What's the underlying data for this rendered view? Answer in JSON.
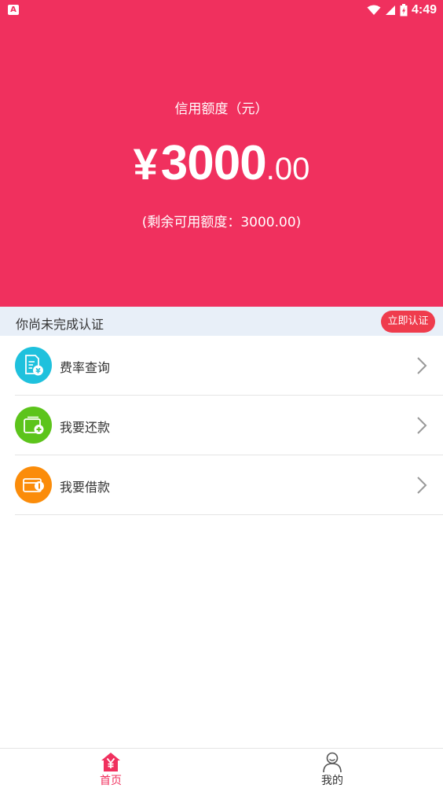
{
  "status_bar": {
    "time": "4:49"
  },
  "credit": {
    "label": "信用额度（元）",
    "currency_symbol": "¥",
    "amount_int": "3000",
    "amount_dec": ".00",
    "remaining": "(剩余可用额度：3000.00)"
  },
  "notice": {
    "text": "你尚未完成认证",
    "button": "立即认证"
  },
  "menu": [
    {
      "label": "费率查询",
      "icon": "rate-query-icon",
      "color": "#1fc1dd"
    },
    {
      "label": "我要还款",
      "icon": "repay-icon",
      "color": "#5cc41b"
    },
    {
      "label": "我要借款",
      "icon": "borrow-icon",
      "color": "#fb8c0a"
    }
  ],
  "tabs": [
    {
      "label": "首页",
      "icon": "home-icon",
      "active": true
    },
    {
      "label": "我的",
      "icon": "user-icon",
      "active": false
    }
  ],
  "colors": {
    "primary": "#f0305e",
    "notice_bg": "#e8eff8",
    "notice_button": "#ef3c4d"
  }
}
